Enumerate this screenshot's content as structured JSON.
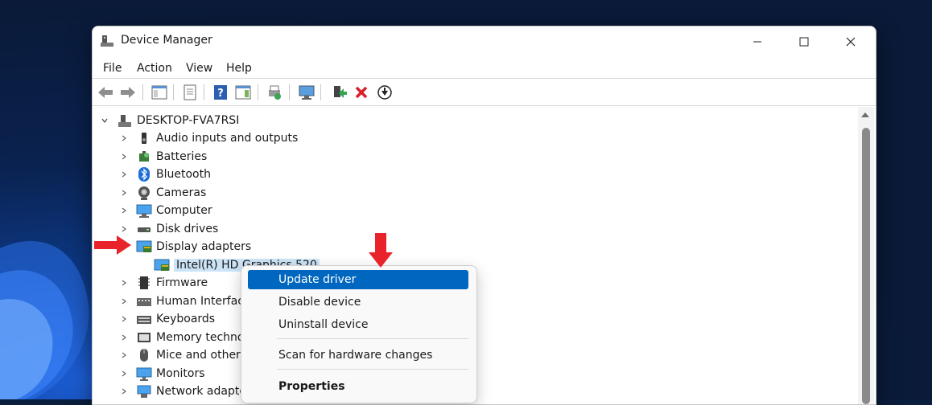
{
  "window": {
    "title": "Device Manager"
  },
  "menu": [
    "File",
    "Action",
    "View",
    "Help"
  ],
  "tree": {
    "root": "DESKTOP-FVA7RSI",
    "items": [
      {
        "label": "Audio inputs and outputs",
        "icon": "speaker-icon"
      },
      {
        "label": "Batteries",
        "icon": "battery-icon"
      },
      {
        "label": "Bluetooth",
        "icon": "bluetooth-icon"
      },
      {
        "label": "Cameras",
        "icon": "camera-icon"
      },
      {
        "label": "Computer",
        "icon": "computer-icon"
      },
      {
        "label": "Disk drives",
        "icon": "disk-drive-icon"
      },
      {
        "label": "Display adapters",
        "icon": "display-adapter-icon",
        "expanded": true
      },
      {
        "label": "Intel(R) HD Graphics 520",
        "icon": "display-adapter-icon",
        "child": true,
        "selected": true
      },
      {
        "label": "Firmware",
        "icon": "firmware-icon"
      },
      {
        "label": "Human Interface Devices",
        "icon": "hid-icon"
      },
      {
        "label": "Keyboards",
        "icon": "keyboard-icon"
      },
      {
        "label": "Memory technology devices",
        "icon": "memory-icon"
      },
      {
        "label": "Mice and other pointing devices",
        "icon": "mouse-icon"
      },
      {
        "label": "Monitors",
        "icon": "monitor-icon"
      },
      {
        "label": "Network adapters",
        "icon": "network-adapter-icon"
      }
    ]
  },
  "context_menu": {
    "update": "Update driver",
    "disable": "Disable device",
    "uninstall": "Uninstall device",
    "scan": "Scan for hardware changes",
    "properties": "Properties"
  },
  "colors": {
    "accent": "#0067c0",
    "selection": "#cce4f7",
    "arrow": "#e8232a"
  }
}
